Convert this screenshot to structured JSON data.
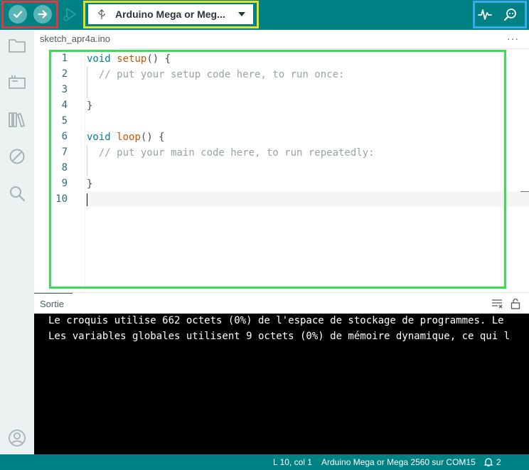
{
  "toolbar": {
    "board_label": "Arduino Mega or Meg..."
  },
  "tabs": [
    {
      "label": "sketch_apr4a.ino"
    }
  ],
  "tab_more": "···",
  "editor": {
    "line_numbers": [
      "1",
      "2",
      "3",
      "4",
      "5",
      "6",
      "7",
      "8",
      "9",
      "10"
    ],
    "lines": [
      {
        "kw": "void ",
        "fn": "setup",
        "rest": "() {"
      },
      {
        "comment": "  // put your setup code here, to run once:"
      },
      {},
      {
        "punct": "}"
      },
      {},
      {
        "kw": "void ",
        "fn": "loop",
        "rest": "() {"
      },
      {
        "comment": "  // put your main code here, to run repeatedly:"
      },
      {},
      {
        "punct": "}"
      },
      {}
    ],
    "active_line": 10
  },
  "output": {
    "title": "Sortie",
    "lines": [
      "Le croquis utilise 662 octets (0%) de l'espace de stockage de programmes. Le",
      "Les variables globales utilisent 9 octets (0%) de mémoire dynamique, ce qui l"
    ]
  },
  "statusbar": {
    "position": "L 10, col 1",
    "board_port": "Arduino Mega or Mega 2560 sur COM15",
    "notifications": "2"
  },
  "colors": {
    "accent": "#008184",
    "highlight_red": "#e8343f",
    "highlight_yellow": "#e6e021",
    "highlight_blue": "#3aa7ef",
    "highlight_green": "#35e055"
  }
}
